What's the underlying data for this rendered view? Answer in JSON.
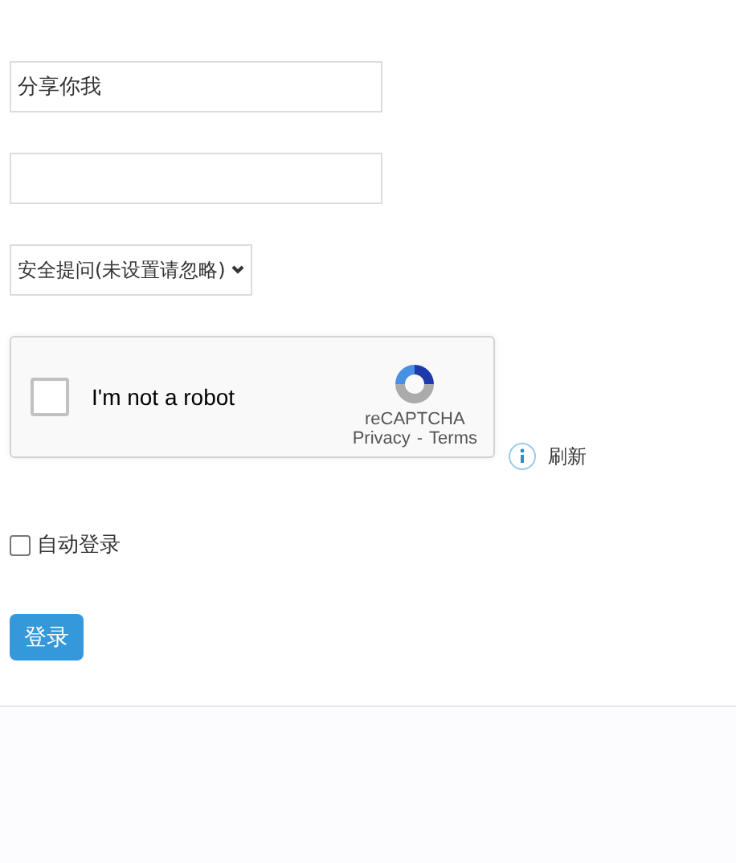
{
  "username": {
    "value": "分享你我"
  },
  "security_question": {
    "value": "安全提问(未设置请忽略)"
  },
  "captcha": {
    "label": "I'm not a robot",
    "checked": false,
    "brand": "reCAPTCHA",
    "privacy": "Privacy",
    "separator": "-",
    "terms": "Terms"
  },
  "refresh": {
    "label": "刷新"
  },
  "auto_login": {
    "label": "自动登录",
    "checked": false
  },
  "login_button": {
    "label": "登录"
  }
}
